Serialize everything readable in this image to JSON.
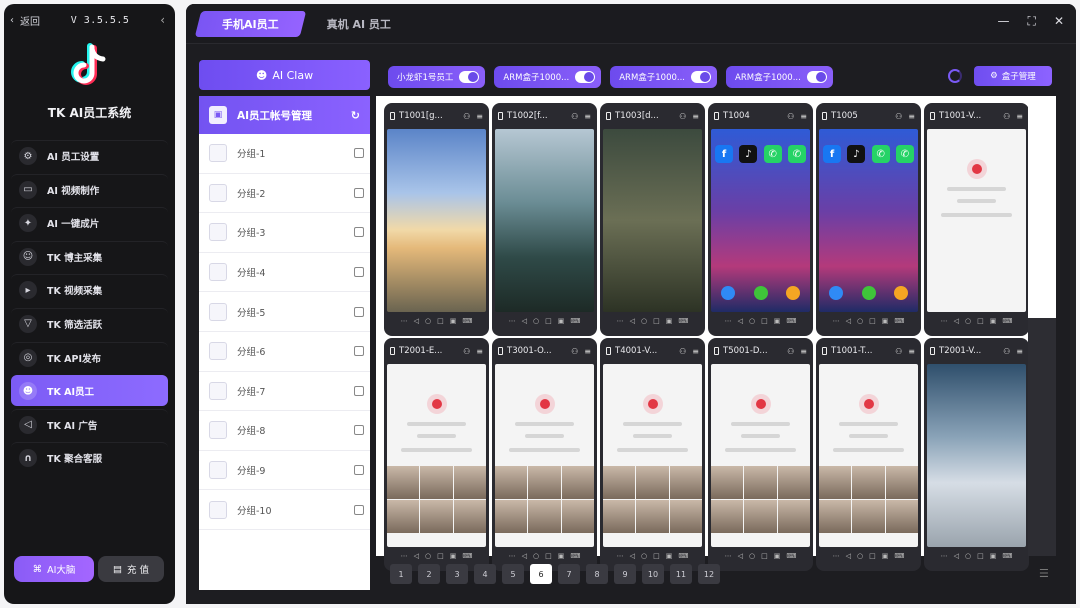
{
  "sidebar": {
    "back_label": "返回",
    "version": "V 3.5.5.5",
    "app_title": "TK AI员工系统",
    "nav": [
      {
        "label": "AI 员工设置",
        "icon": "gear-icon",
        "active": false
      },
      {
        "label": "AI 视频制作",
        "icon": "video-camera-icon",
        "active": false
      },
      {
        "label": "AI 一键成片",
        "icon": "ai-spark-icon",
        "active": false
      },
      {
        "label": "TK 博主采集",
        "icon": "users-icon",
        "active": false
      },
      {
        "label": "TK 视频采集",
        "icon": "video-record-icon",
        "active": false
      },
      {
        "label": "TK 筛选活跃",
        "icon": "filter-icon",
        "active": false
      },
      {
        "label": "TK API发布",
        "icon": "target-icon",
        "active": false
      },
      {
        "label": "TK AI员工",
        "icon": "robot-icon",
        "active": true
      },
      {
        "label": "TK AI 广告",
        "icon": "megaphone-icon",
        "active": false
      },
      {
        "label": "TK 聚合客服",
        "icon": "headset-icon",
        "active": false
      }
    ],
    "brain_label": "AI大脑",
    "recharge_label": "充 值"
  },
  "titlebar": {
    "tabs": [
      {
        "label": "手机AI员工",
        "active": true
      },
      {
        "label": "真机 AI 员工",
        "active": false
      }
    ]
  },
  "panel": {
    "claw_label": "AI Claw",
    "accounts_title": "AI员工帐号管理",
    "groups": [
      "分组-1",
      "分组-2",
      "分组-3",
      "分组-4",
      "分组-5",
      "分组-6",
      "分组-7",
      "分组-8",
      "分组-9",
      "分组-10"
    ]
  },
  "toolbar": {
    "pills": [
      "小龙虾1号员工",
      "ARM盒子1000...",
      "ARM盒子1000...",
      "ARM盒子1000..."
    ],
    "box_manage_label": "盒子管理"
  },
  "devices": [
    {
      "name": "T1001[g...",
      "screen": "sky"
    },
    {
      "name": "T1002[f...",
      "screen": "fall"
    },
    {
      "name": "T1003[d...",
      "screen": "phone"
    },
    {
      "name": "T1004",
      "screen": "home"
    },
    {
      "name": "T1005",
      "screen": "home"
    },
    {
      "name": "T1001-V...",
      "screen": "profile-empty"
    },
    {
      "name": "T2001-E...",
      "screen": "profile"
    },
    {
      "name": "T3001-O...",
      "screen": "profile"
    },
    {
      "name": "T4001-V...",
      "screen": "profile"
    },
    {
      "name": "T5001-D...",
      "screen": "profile"
    },
    {
      "name": "T1001-T...",
      "screen": "profile"
    },
    {
      "name": "T2001-V...",
      "screen": "snow"
    }
  ],
  "pager": {
    "pages": [
      "1",
      "2",
      "3",
      "4",
      "5",
      "6",
      "7",
      "8",
      "9",
      "10",
      "11",
      "12"
    ],
    "current": "6"
  },
  "colors": {
    "accent": "#7c5cf5",
    "sidebar_bg": "#161618",
    "main_bg": "#1d1d21"
  }
}
